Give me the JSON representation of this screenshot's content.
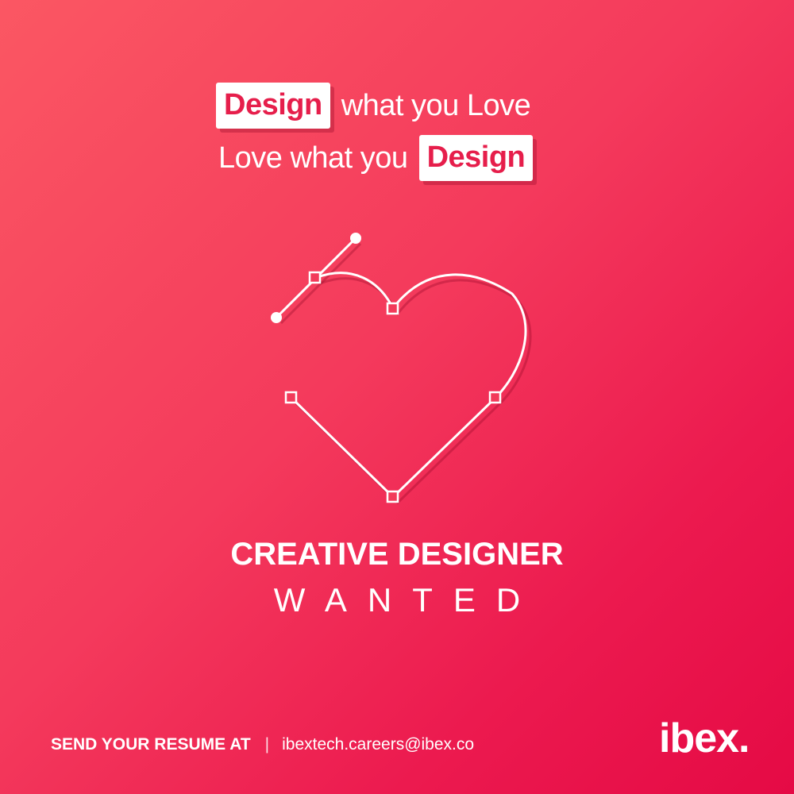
{
  "tagline": {
    "line1_highlight": "Design",
    "line1_text": "what you Love",
    "line2_text": "Love what you",
    "line2_highlight": "Design"
  },
  "graphic": {
    "icon": "heart-bezier-path-icon",
    "stroke_color": "#ffffff"
  },
  "headline": "CREATIVE DESIGNER",
  "subheadline": "WANTED",
  "footer": {
    "cta": "SEND YOUR RESUME AT",
    "separator": "|",
    "email": "ibextech.careers@ibex.co"
  },
  "logo": "ibex.",
  "colors": {
    "background_start": "#fb5763",
    "background_end": "#e50a45",
    "accent": "#e61e4b",
    "text": "#ffffff"
  }
}
